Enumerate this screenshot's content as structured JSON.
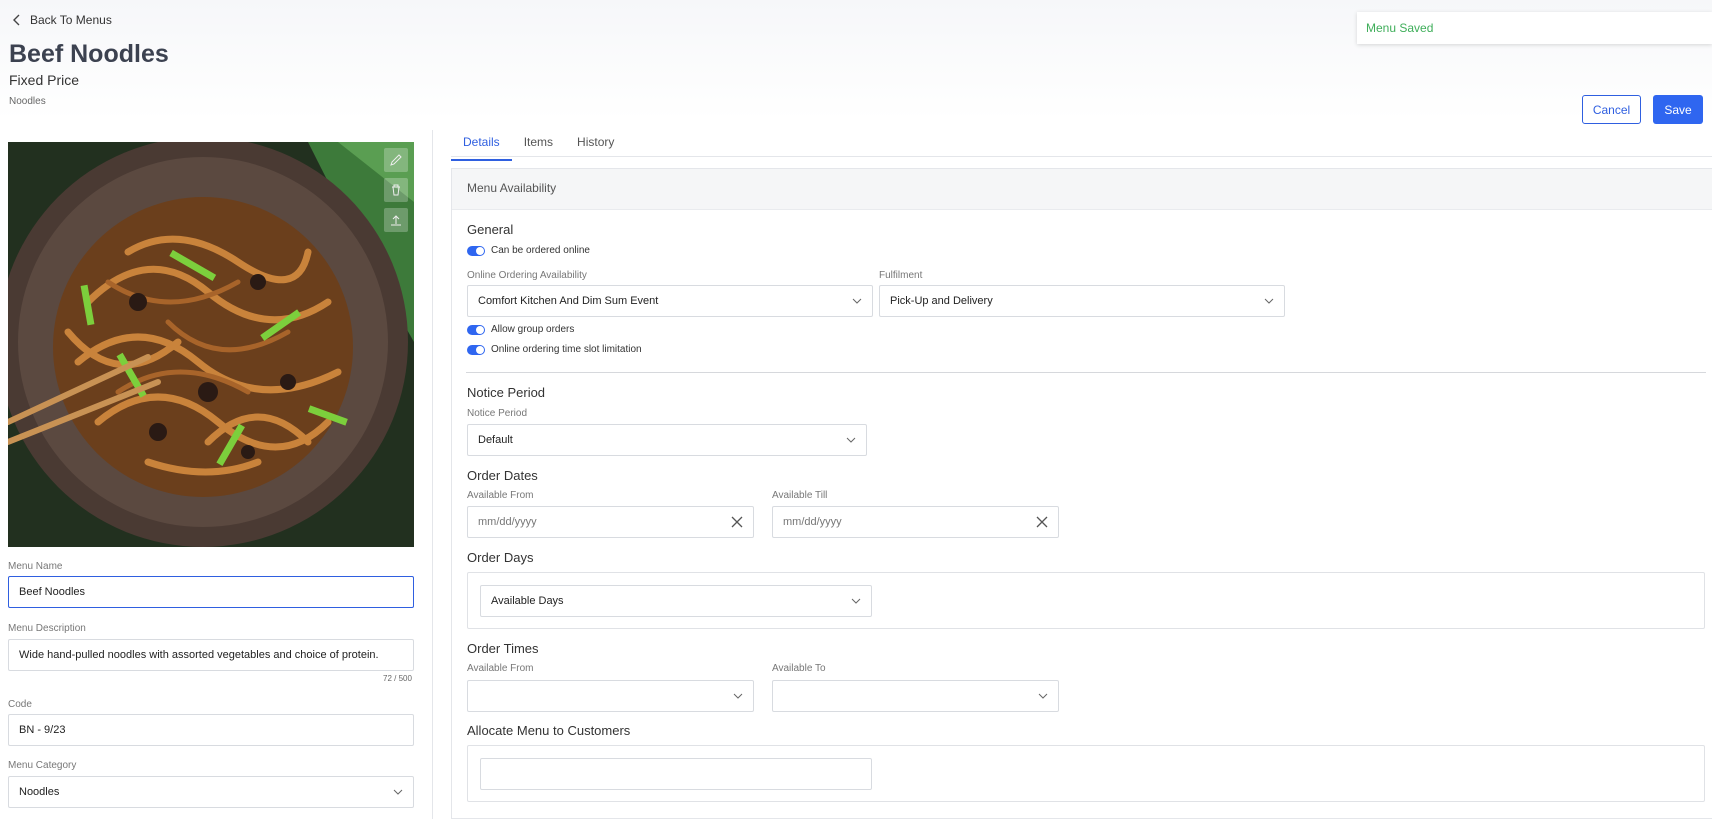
{
  "header": {
    "back_label": "Back To Menus",
    "title": "Beef Noodles",
    "subtitle": "Fixed Price",
    "category_crumb": "Noodles"
  },
  "toast": {
    "message": "Menu Saved"
  },
  "actions": {
    "cancel_label": "Cancel",
    "save_label": "Save"
  },
  "left": {
    "menu_name_label": "Menu Name",
    "menu_name_value": "Beef Noodles",
    "menu_description_label": "Menu Description",
    "menu_description_value": "Wide hand-pulled noodles with assorted vegetables and choice of protein.",
    "description_counter": "72 / 500",
    "code_label": "Code",
    "code_value": "BN - 9/23",
    "menu_category_label": "Menu Category",
    "menu_category_value": "Noodles"
  },
  "tabs": [
    {
      "label": "Details"
    },
    {
      "label": "Items"
    },
    {
      "label": "History"
    }
  ],
  "availability": {
    "panel_title": "Menu Availability",
    "general_title": "General",
    "can_order_online": "Can be ordered online",
    "online_availability_label": "Online Ordering Availability",
    "online_availability_value": "Comfort Kitchen And Dim Sum Event",
    "fulfilment_label": "Fulfilment",
    "fulfilment_value": "Pick-Up and Delivery",
    "allow_group_orders": "Allow group orders",
    "time_slot_limitation": "Online ordering time slot limitation",
    "notice_period_title": "Notice Period",
    "notice_period_label": "Notice Period",
    "notice_period_value": "Default",
    "order_dates_title": "Order Dates",
    "available_from_label": "Available From",
    "available_from_placeholder": "mm/dd/yyyy",
    "available_till_label": "Available Till",
    "available_till_placeholder": "mm/dd/yyyy",
    "order_days_title": "Order Days",
    "available_days_value": "Available Days",
    "order_times_title": "Order Times",
    "times_from_label": "Available From",
    "times_to_label": "Available To",
    "allocate_title": "Allocate Menu to Customers"
  },
  "colors": {
    "primary": "#2f66f0",
    "toast_text": "#3fae5a",
    "title": "#3c4250"
  }
}
